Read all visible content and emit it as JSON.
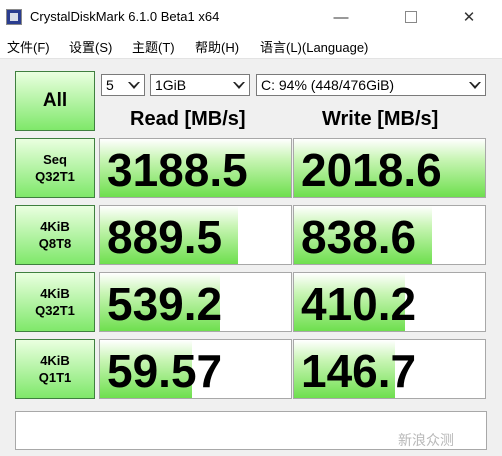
{
  "window": {
    "title": "CrystalDiskMark 6.1.0 Beta1 x64",
    "minimize": "—",
    "close": "✕"
  },
  "menu": [
    "文件(F)",
    "设置(S)",
    "主题(T)",
    "帮助(H)",
    "语言(L)(Language)"
  ],
  "controls": {
    "all_label": "All",
    "count": "5",
    "size": "1GiB",
    "drive": "C: 94% (448/476GiB)"
  },
  "headers": {
    "read": "Read [MB/s]",
    "write": "Write [MB/s]"
  },
  "rows": [
    {
      "line1": "Seq",
      "line2": "Q32T1",
      "read": "3188.5",
      "write": "2018.6",
      "read_fill": 1.0,
      "write_fill": 1.0
    },
    {
      "line1": "4KiB",
      "line2": "Q8T8",
      "read": "889.5",
      "write": "838.6",
      "read_fill": 0.72,
      "write_fill": 0.72
    },
    {
      "line1": "4KiB",
      "line2": "Q32T1",
      "read": "539.2",
      "write": "410.2",
      "read_fill": 0.63,
      "write_fill": 0.58
    },
    {
      "line1": "4KiB",
      "line2": "Q1T1",
      "read": "59.57",
      "write": "146.7",
      "read_fill": 0.48,
      "write_fill": 0.53
    }
  ],
  "watermark": "新浪众测",
  "colors": {
    "accent_green": "#6edf4e",
    "border_green": "#3f7f3f"
  }
}
